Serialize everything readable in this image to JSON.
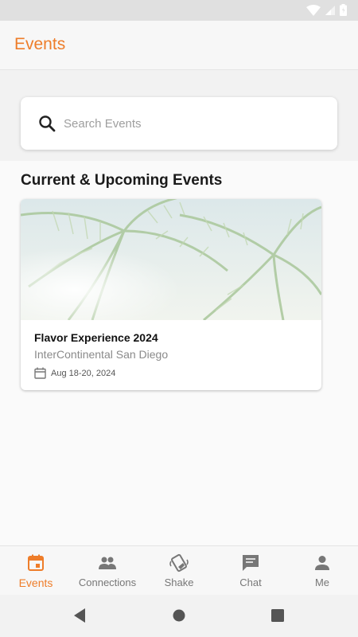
{
  "app_bar": {
    "title": "Events"
  },
  "search": {
    "placeholder": "Search Events",
    "value": ""
  },
  "section": {
    "title": "Current & Upcoming Events"
  },
  "events": [
    {
      "name": "Flavor Experience 2024",
      "venue": "InterContinental San Diego",
      "date": "Aug 18-20, 2024",
      "image_icon": "palm-trees-image"
    }
  ],
  "bottom_nav": {
    "items": [
      {
        "label": "Events",
        "icon": "calendar-icon",
        "active": true
      },
      {
        "label": "Connections",
        "icon": "people-icon",
        "active": false
      },
      {
        "label": "Shake",
        "icon": "shake-phone-icon",
        "active": false
      },
      {
        "label": "Chat",
        "icon": "chat-icon",
        "active": false
      },
      {
        "label": "Me",
        "icon": "person-icon",
        "active": false
      }
    ]
  },
  "colors": {
    "accent": "#ee7d2a",
    "inactive": "#777777"
  }
}
